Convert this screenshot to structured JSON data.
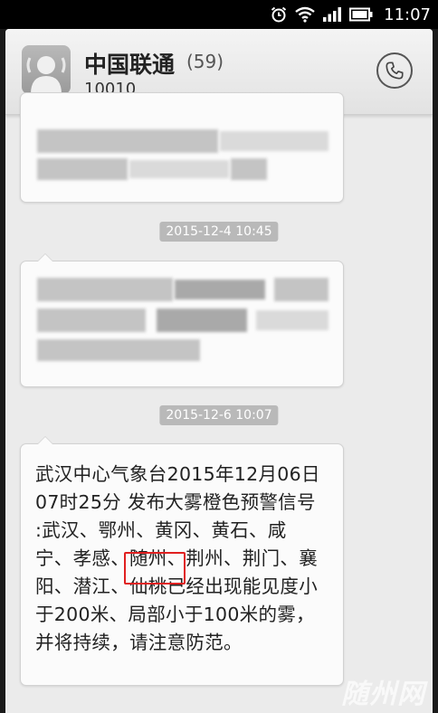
{
  "status_bar": {
    "time": "11:07",
    "icons": [
      "alarm-icon",
      "wifi-icon",
      "signal-icon",
      "battery-icon"
    ]
  },
  "header": {
    "contact_name": "中国联通",
    "message_count": "(59)",
    "contact_number": "10010",
    "icons": [
      "avatar-icon",
      "phone-icon"
    ]
  },
  "timestamps": [
    "2015-12-4 10:45",
    "2015-12-6 10:07"
  ],
  "messages": {
    "last": {
      "lines": [
        "武汉中心气象台2015年12月06日",
        "07时25分 发布大雾橙色预警信号",
        ":武汉、鄂州、黄冈、黄石、咸",
        "宁、孝感、随州、荆州、荆门、襄",
        "阳、潜江、仙桃已经出现能见度小",
        "于200米、局部小于100米的雾，",
        "并将持续，请注意防范。"
      ],
      "highlighted_word": "随州、"
    }
  },
  "watermark": "随州网",
  "colors": {
    "highlight": "#e02020",
    "timestamp_bg": "#b9b9b9",
    "bubble_bg": "#fbfbfb"
  }
}
